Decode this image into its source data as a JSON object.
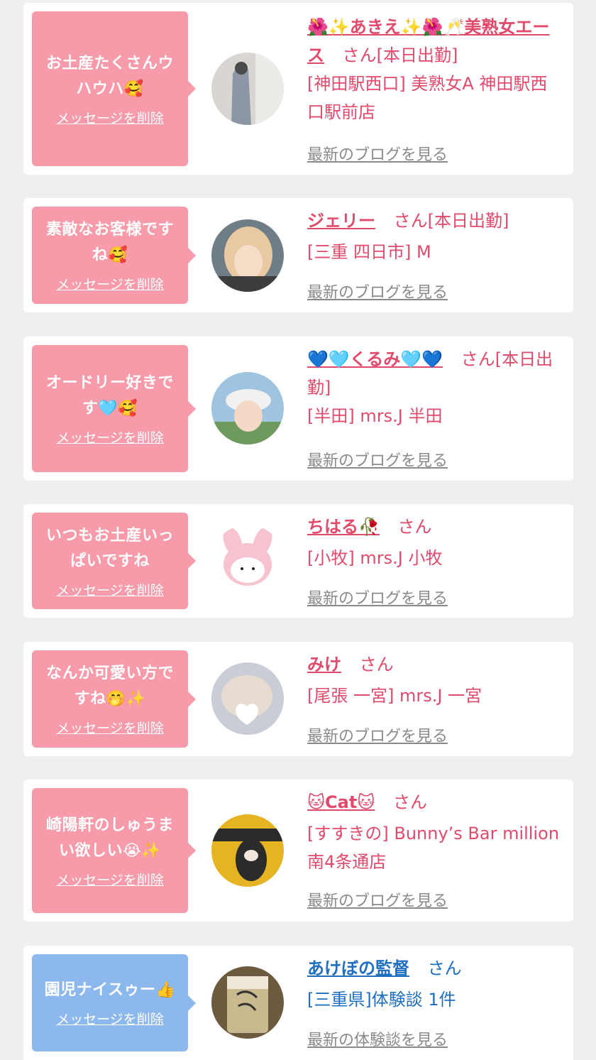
{
  "items": [
    {
      "message": "お土産たくさんウハウハ🥰",
      "delete_label": "メッセージを削除",
      "name": "🌺✨あきえ✨🌺🥂美熟女エース",
      "suffix": "さん[本日出勤]",
      "shop": "[神田駅西口] 美熟女A 神田駅西口駅前店",
      "blog_label": "最新のブログを見る",
      "bubble_color": "#f79aa9",
      "avatar_colors": [
        "#8d96a6",
        "#d9d6d2"
      ]
    },
    {
      "message": "素敵なお客様ですね🥰",
      "delete_label": "メッセージを削除",
      "name": "ジェリー",
      "suffix": "さん[本日出勤]",
      "shop": "[三重 四日市] M",
      "blog_label": "最新のブログを見る",
      "bubble_color": "#f79aa9",
      "avatar_colors": [
        "#e9c9a2",
        "#6e7d86"
      ]
    },
    {
      "message": "オードリー好きです🩵🥰",
      "delete_label": "メッセージを削除",
      "name": "💙🩵くるみ🩵💙",
      "suffix": "さん[本日出勤]",
      "shop": "[半田] mrs.J 半田",
      "blog_label": "最新のブログを見る",
      "bubble_color": "#f79aa9",
      "avatar_colors": [
        "#9fc4e0",
        "#f1f1f1"
      ]
    },
    {
      "message": "いつもお土産いっぱいですね",
      "delete_label": "メッセージを削除",
      "name": "ちはる🥀",
      "suffix": "さん",
      "shop": "[小牧] mrs.J 小牧",
      "blog_label": "最新のブログを見る",
      "bubble_color": "#f79aa9",
      "avatar_colors": [
        "#f6c3cf",
        "#ffffff"
      ]
    },
    {
      "message": "なんか可愛い方ですね🤭✨",
      "delete_label": "メッセージを削除",
      "name": "みけ",
      "suffix": "さん",
      "shop": "[尾張 一宮] mrs.J 一宮",
      "blog_label": "最新のブログを見る",
      "bubble_color": "#f79aa9",
      "avatar_colors": [
        "#c9ced6",
        "#f3f3f3"
      ]
    },
    {
      "message": "崎陽軒のしゅうまい欲しい😭✨",
      "delete_label": "メッセージを削除",
      "name": "🐱Cat🐱",
      "suffix": "さん",
      "shop": "[すすきの] Bunny’s Bar million 南4条通店",
      "blog_label": "最新のブログを見る",
      "bubble_color": "#f79aa9",
      "avatar_colors": [
        "#e6b323",
        "#2b2b2b"
      ]
    },
    {
      "message": "園児ナイスゥー👍",
      "delete_label": "メッセージを削除",
      "name": "あけぼの監督",
      "suffix": "さん",
      "shop": "[三重県]体験談 1件",
      "blog_label": "最新の体験談を見る",
      "bubble_color": "#8db8ee",
      "avatar_colors": [
        "#6b5a3e",
        "#c9b98f"
      ]
    }
  ]
}
